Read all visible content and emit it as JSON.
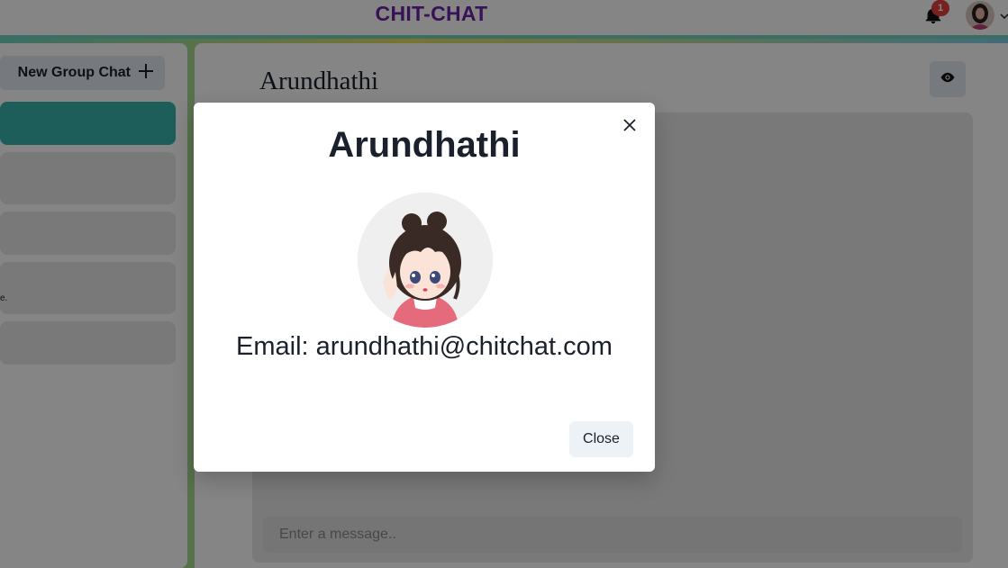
{
  "header": {
    "brand": "CHIT-CHAT",
    "notification_count": "1",
    "brand_color": "#6b21a8",
    "badge_color": "#e53e3e"
  },
  "sidebar": {
    "new_group_label": "New Group Chat",
    "selected_color": "#38b2ac",
    "preview_fragment": "e."
  },
  "chat": {
    "title": "Arundhathi",
    "input_placeholder": "Enter a message.."
  },
  "modal": {
    "title": "Arundhathi",
    "email_line": "Email: arundhathi@chitchat.com",
    "close_label": "Close"
  },
  "icons": {
    "notification": "bell-icon",
    "avatar_caret": "chevron-down-icon",
    "new_group": "plus-icon",
    "view_profile": "eye-icon",
    "modal_close": "close-icon"
  }
}
